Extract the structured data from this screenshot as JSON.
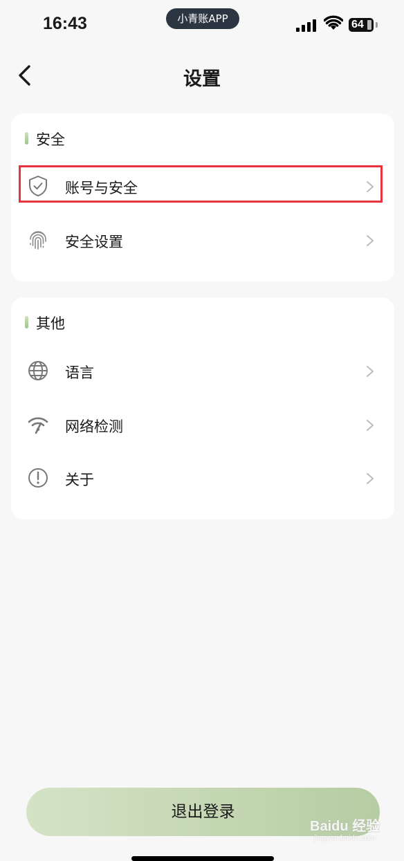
{
  "status_bar": {
    "time": "16:43",
    "app_pill": "小青账APP",
    "battery": "64"
  },
  "nav": {
    "title": "设置",
    "back_icon": "chevron-left-icon"
  },
  "sections": {
    "security": {
      "title": "安全",
      "items": [
        {
          "label": "账号与安全",
          "icon": "shield-check-icon",
          "highlighted": true
        },
        {
          "label": "安全设置",
          "icon": "fingerprint-icon"
        }
      ]
    },
    "other": {
      "title": "其他",
      "items": [
        {
          "label": "语言",
          "icon": "globe-icon"
        },
        {
          "label": "网络检测",
          "icon": "wifi-check-icon"
        },
        {
          "label": "关于",
          "icon": "info-exclamation-icon"
        }
      ]
    }
  },
  "logout_label": "退出登录",
  "watermark": {
    "brand": "Baidu 经验",
    "url": "jingyan.baidu.com"
  },
  "colors": {
    "accent_green": "#b6cca2",
    "highlight_red": "#e8323c",
    "background": "#f7f7f7"
  }
}
